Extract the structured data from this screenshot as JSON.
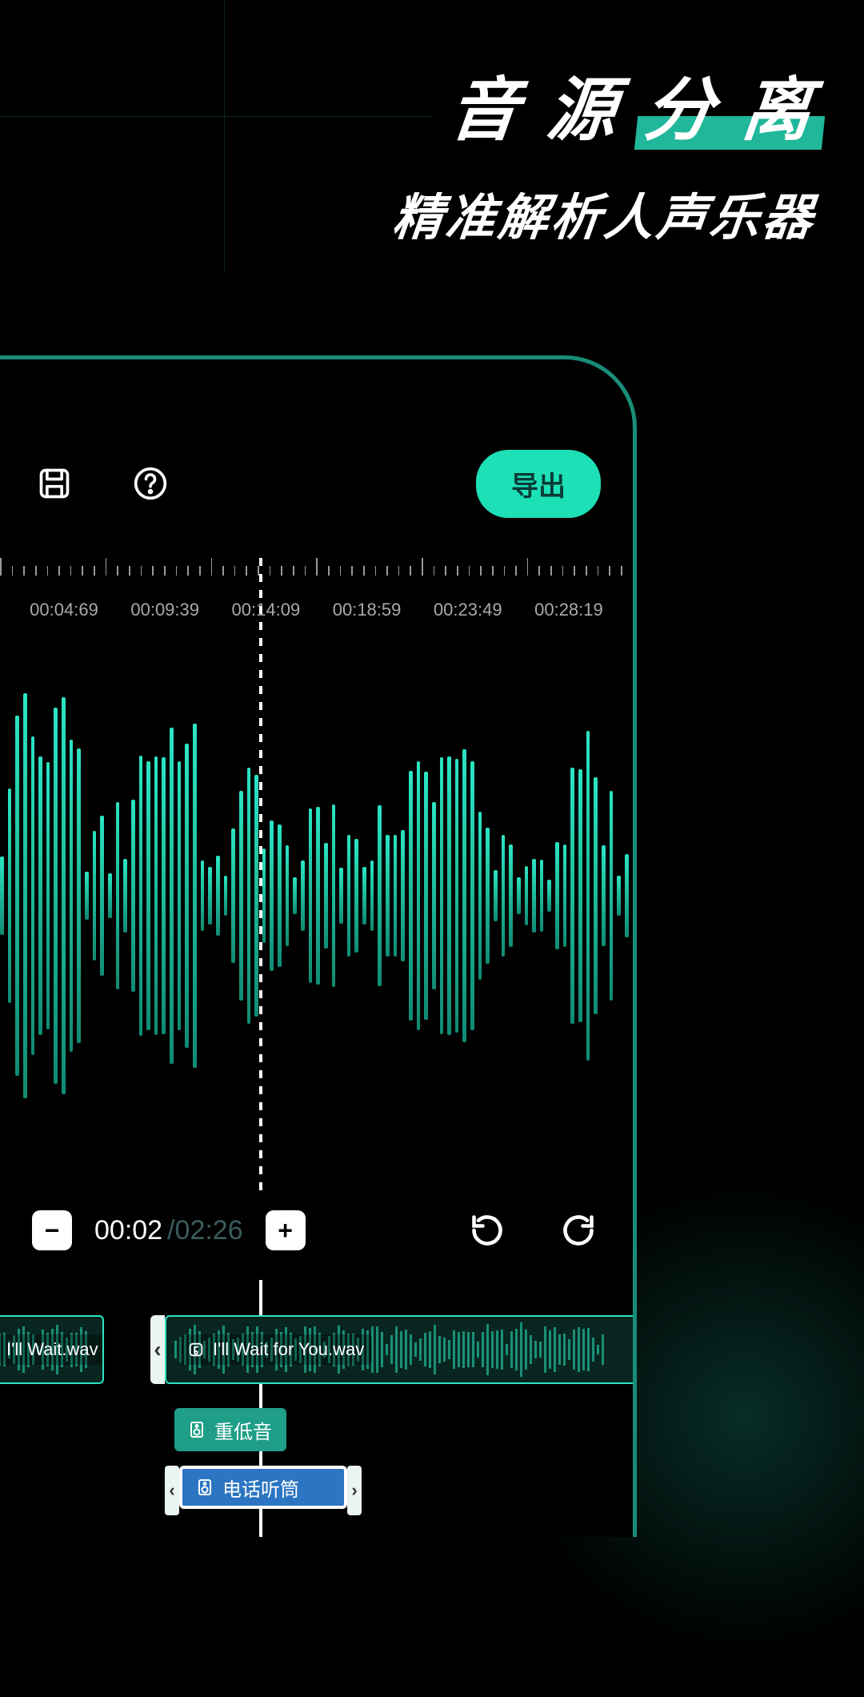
{
  "headline": {
    "line1_part1": "音 源",
    "line1_accent": "分 离",
    "line2": "精准解析人声乐器"
  },
  "toolbar": {
    "export_label": "导出"
  },
  "ruler": {
    "labels": [
      "00:04:69",
      "00:09:39",
      "00:14:09",
      "00:18:59",
      "00:23:49",
      "00:28:19"
    ]
  },
  "playback": {
    "current": "00:02",
    "separator": "/",
    "total": "02:26"
  },
  "clips": {
    "partial_left": "I'll Wait.wav",
    "main": "I'll Wait for You.wav",
    "bass_chip": "重低音",
    "phone_chip": "电话听筒"
  },
  "colors": {
    "accent": "#1ee0b7",
    "wave": "#2be5c2"
  }
}
